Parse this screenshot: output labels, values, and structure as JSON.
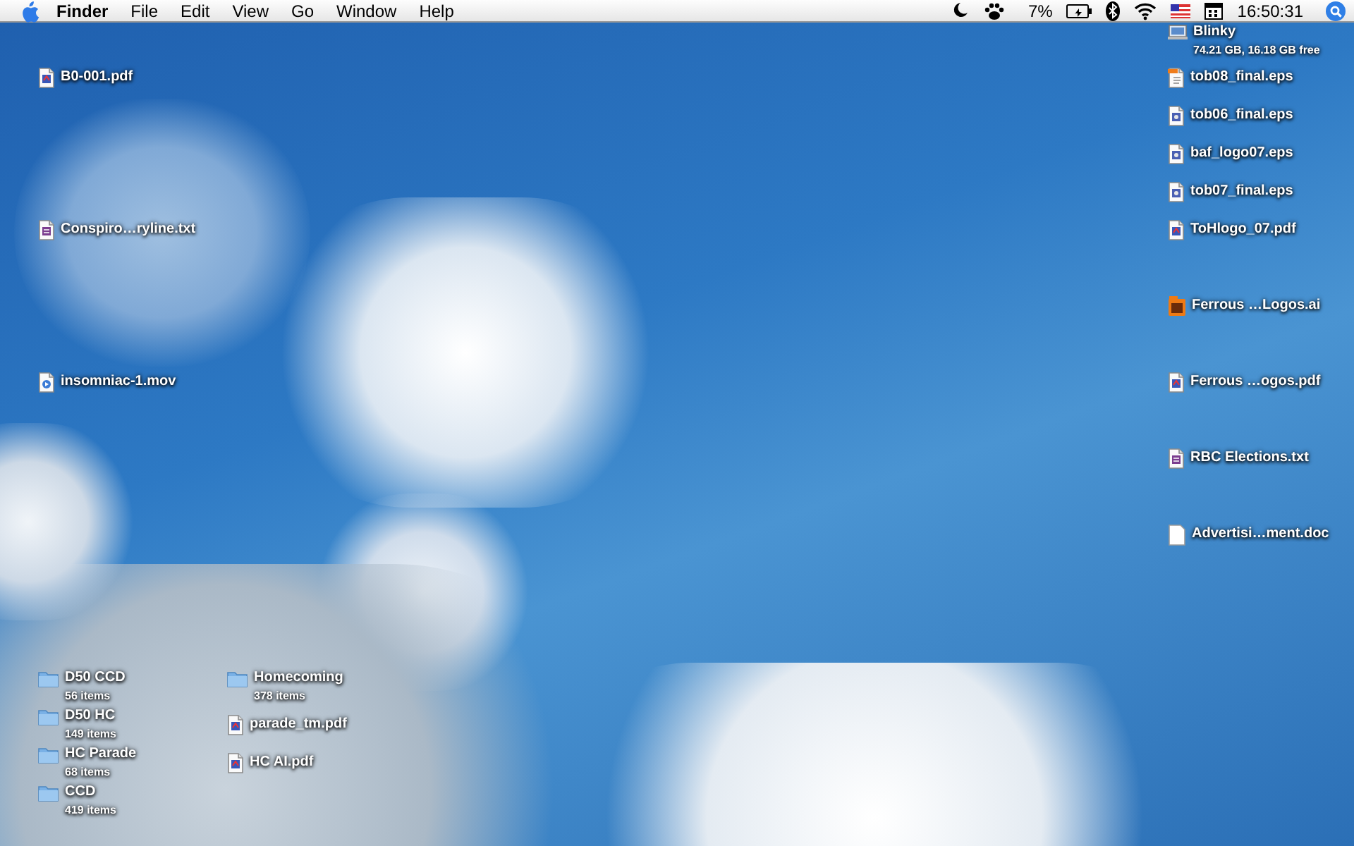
{
  "menu_bar": {
    "app_name": "Finder",
    "menus": [
      "File",
      "Edit",
      "View",
      "Go",
      "Window",
      "Help"
    ],
    "battery_percent": "7%",
    "clock": "16:50:31"
  },
  "desktop": {
    "left_icons": [
      {
        "name": "B0-001.pdf",
        "kind": "pdf"
      },
      {
        "name": "Conspiro…ryline.txt",
        "kind": "txt"
      },
      {
        "name": "insomniac-1.mov",
        "kind": "mov"
      }
    ],
    "right_icons": [
      {
        "name": "Blinky",
        "subtitle": "74.21 GB, 16.18 GB free",
        "kind": "disk"
      },
      {
        "name": "tob08_final.eps",
        "kind": "eps-doc"
      },
      {
        "name": "tob06_final.eps",
        "kind": "eps"
      },
      {
        "name": "baf_logo07.eps",
        "kind": "eps"
      },
      {
        "name": "tob07_final.eps",
        "kind": "eps"
      },
      {
        "name": "ToHlogo_07.pdf",
        "kind": "pdf"
      },
      {
        "name": "Ferrous …Logos.ai",
        "kind": "ai"
      },
      {
        "name": "Ferrous …ogos.pdf",
        "kind": "pdf"
      },
      {
        "name": "RBC Elections.txt",
        "kind": "txt"
      },
      {
        "name": "Advertisi…ment.doc",
        "kind": "doc"
      }
    ],
    "bottom_icons": [
      {
        "name": "D50 CCD",
        "subtitle": "56 items",
        "kind": "folder"
      },
      {
        "name": "D50 HC",
        "subtitle": "149 items",
        "kind": "folder"
      },
      {
        "name": "HC Parade",
        "subtitle": "68 items",
        "kind": "folder"
      },
      {
        "name": "CCD",
        "subtitle": "419 items",
        "kind": "folder"
      },
      {
        "name": "Homecoming",
        "subtitle": "378 items",
        "kind": "folder"
      },
      {
        "name": "parade_tm.pdf",
        "kind": "pdf"
      },
      {
        "name": "HC AI.pdf",
        "kind": "pdf"
      }
    ]
  }
}
